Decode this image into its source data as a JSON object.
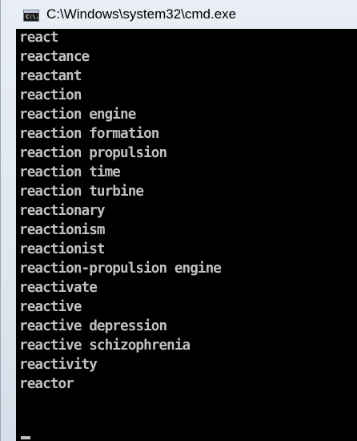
{
  "window": {
    "title": "C:\\Windows\\system32\\cmd.exe",
    "icon": "cmd-icon",
    "icon_glyph": "C:\\."
  },
  "console": {
    "lines": [
      "react",
      "reactance",
      "reactant",
      "reaction",
      "reaction engine",
      "reaction formation",
      "reaction propulsion",
      "reaction time",
      "reaction turbine",
      "reactionary",
      "reactionism",
      "reactionist",
      "reaction-propulsion engine",
      "reactivate",
      "reactive",
      "reactive depression",
      "reactive schizophrenia",
      "reactivity",
      "reactor"
    ],
    "text_color": "#c0c0c0",
    "background_color": "#000000"
  }
}
